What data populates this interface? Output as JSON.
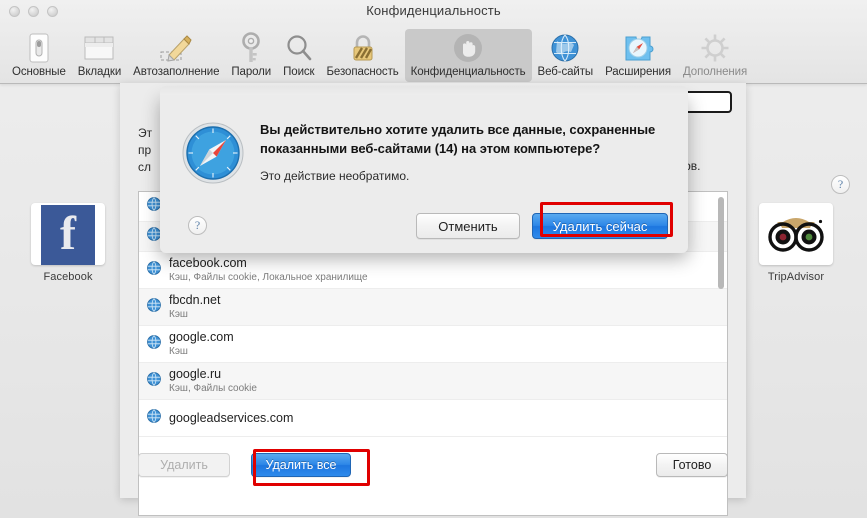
{
  "window": {
    "title": "Конфиденциальность",
    "traffic_lights": [
      "close-button",
      "minimize-button",
      "zoom-button"
    ]
  },
  "toolbar": {
    "items": [
      {
        "label": "Основные",
        "icon": "general-icon",
        "selected": false,
        "dim": false
      },
      {
        "label": "Вкладки",
        "icon": "tabs-icon",
        "selected": false,
        "dim": false
      },
      {
        "label": "Автозаполнение",
        "icon": "autofill-icon",
        "selected": false,
        "dim": false
      },
      {
        "label": "Пароли",
        "icon": "key-icon",
        "selected": false,
        "dim": false
      },
      {
        "label": "Поиск",
        "icon": "search-icon",
        "selected": false,
        "dim": false
      },
      {
        "label": "Безопасность",
        "icon": "lock-icon",
        "selected": false,
        "dim": false
      },
      {
        "label": "Конфиденциальность",
        "icon": "hand-icon",
        "selected": true,
        "dim": false
      },
      {
        "label": "Веб-сайты",
        "icon": "globe-icon",
        "selected": false,
        "dim": false
      },
      {
        "label": "Расширения",
        "icon": "extensions-icon",
        "selected": false,
        "dim": false
      },
      {
        "label": "Дополнения",
        "icon": "advanced-icon",
        "selected": false,
        "dim": true
      }
    ]
  },
  "pane": {
    "search_value": "",
    "search_placeholder": "",
    "description_line1": "Эт",
    "description_line2": "пр",
    "description_line3": "сл",
    "description_tail": "йтов.",
    "sites": [
      {
        "name": "facebook.com",
        "details": "Кэш, Файлы cookie, Локальное хранилище",
        "icon": "globe-icon"
      },
      {
        "name": "fbcdn.net",
        "details": "Кэш",
        "icon": "globe-icon"
      },
      {
        "name": "google.com",
        "details": "Кэш",
        "icon": "globe-icon"
      },
      {
        "name": "google.ru",
        "details": "Кэш, Файлы cookie",
        "icon": "globe-icon"
      },
      {
        "name": "googleadservices.com",
        "details": "",
        "icon": "globe-icon"
      }
    ],
    "hidden_row_detail": "Кэш",
    "buttons": {
      "remove": "Удалить",
      "remove_all": "Удалить все",
      "done": "Готово"
    },
    "help_label": "?"
  },
  "alert": {
    "icon": "safari-compass-icon",
    "title": "Вы действительно хотите удалить все данные, сохраненные показанными веб-сайтами (14) на этом компьютере?",
    "subtitle": "Это действие необратимо.",
    "help_label": "?",
    "cancel_label": "Отменить",
    "confirm_label": "Удалить сейчас"
  },
  "favorites": [
    {
      "label": "Facebook",
      "icon": "facebook-icon"
    },
    {
      "label": "TripAdvisor",
      "icon": "tripadvisor-owl-icon"
    }
  ],
  "annotations": {
    "highlight_color": "#e00000",
    "highlighted": [
      "Удалить сейчас",
      "Удалить все"
    ]
  },
  "colors": {
    "accent_blue": "#2d87e8",
    "highlight_red": "#e00000",
    "toolbar_selected": "#c9c9c9"
  }
}
